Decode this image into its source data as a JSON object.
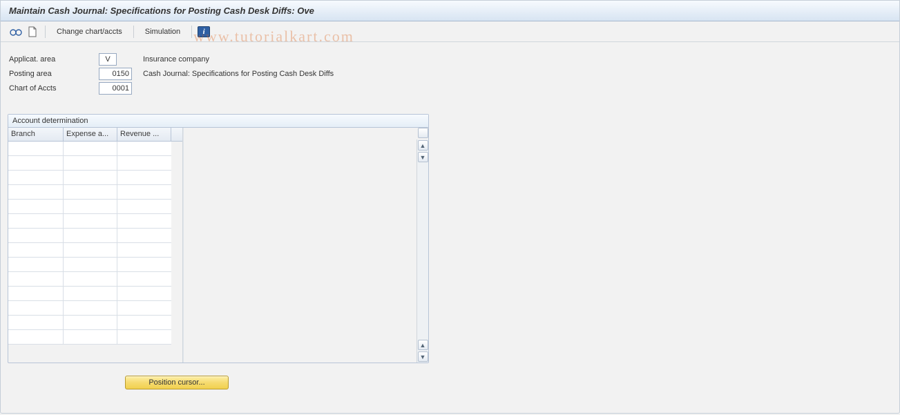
{
  "title": "Maintain Cash Journal: Specifications for Posting Cash Desk Diffs: Ove",
  "toolbar": {
    "change_chart_accts": "Change chart/accts",
    "simulation": "Simulation"
  },
  "watermark": "www.tutorialkart.com",
  "form": {
    "applicat_area": {
      "label": "Applicat. area",
      "value": "V",
      "desc": "Insurance company"
    },
    "posting_area": {
      "label": "Posting area",
      "value": "0150",
      "desc": "Cash Journal: Specifications for Posting Cash Desk Diffs"
    },
    "chart_accts": {
      "label": "Chart of Accts",
      "value": "0001",
      "desc": ""
    }
  },
  "group": {
    "title": "Account determination",
    "columns": {
      "branch": "Branch",
      "expense": "Expense a...",
      "revenue": "Revenue ..."
    },
    "rows": [
      {
        "branch": "",
        "expense": "",
        "revenue": ""
      },
      {
        "branch": "",
        "expense": "",
        "revenue": ""
      },
      {
        "branch": "",
        "expense": "",
        "revenue": ""
      },
      {
        "branch": "",
        "expense": "",
        "revenue": ""
      },
      {
        "branch": "",
        "expense": "",
        "revenue": ""
      },
      {
        "branch": "",
        "expense": "",
        "revenue": ""
      },
      {
        "branch": "",
        "expense": "",
        "revenue": ""
      },
      {
        "branch": "",
        "expense": "",
        "revenue": ""
      },
      {
        "branch": "",
        "expense": "",
        "revenue": ""
      },
      {
        "branch": "",
        "expense": "",
        "revenue": ""
      },
      {
        "branch": "",
        "expense": "",
        "revenue": ""
      },
      {
        "branch": "",
        "expense": "",
        "revenue": ""
      },
      {
        "branch": "",
        "expense": "",
        "revenue": ""
      },
      {
        "branch": "",
        "expense": "",
        "revenue": ""
      }
    ]
  },
  "buttons": {
    "position_cursor": "Position cursor..."
  }
}
